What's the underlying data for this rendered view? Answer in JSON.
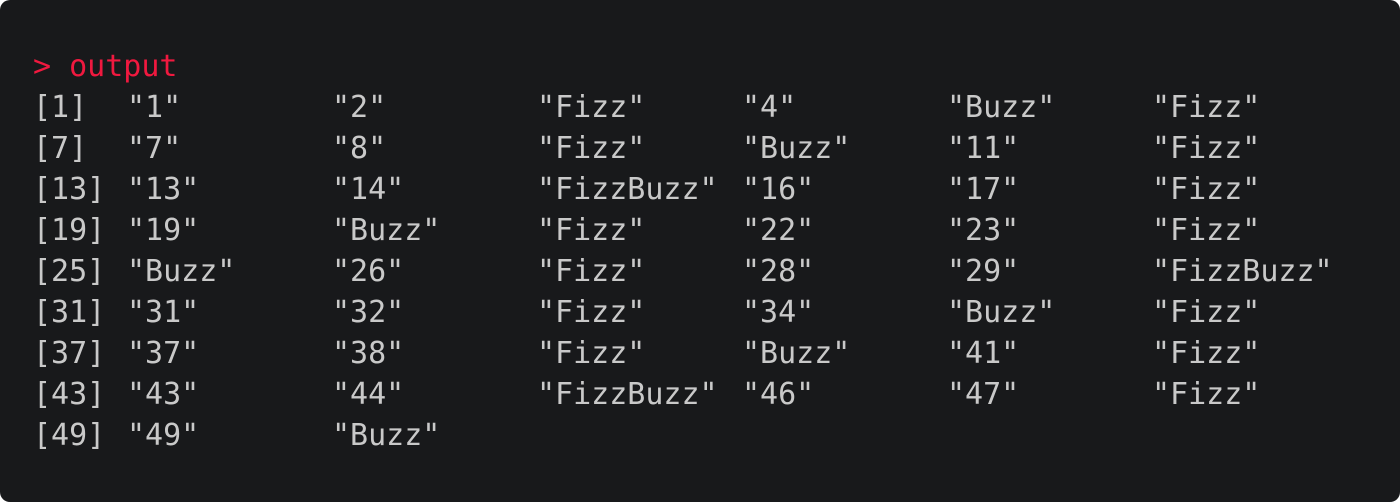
{
  "prompt": {
    "symbol": ">",
    "command": "output",
    "color": "#f0193f"
  },
  "colors": {
    "background": "#18191b",
    "text": "#c9c9c9"
  },
  "rows": [
    {
      "index": "[1]",
      "values": [
        "\"1\"",
        "\"2\"",
        "\"Fizz\"",
        "\"4\"",
        "\"Buzz\"",
        "\"Fizz\""
      ]
    },
    {
      "index": "[7]",
      "values": [
        "\"7\"",
        "\"8\"",
        "\"Fizz\"",
        "\"Buzz\"",
        "\"11\"",
        "\"Fizz\""
      ]
    },
    {
      "index": "[13]",
      "values": [
        "\"13\"",
        "\"14\"",
        "\"FizzBuzz\"",
        "\"16\"",
        "\"17\"",
        "\"Fizz\""
      ]
    },
    {
      "index": "[19]",
      "values": [
        "\"19\"",
        "\"Buzz\"",
        "\"Fizz\"",
        "\"22\"",
        "\"23\"",
        "\"Fizz\""
      ]
    },
    {
      "index": "[25]",
      "values": [
        "\"Buzz\"",
        "\"26\"",
        "\"Fizz\"",
        "\"28\"",
        "\"29\"",
        "\"FizzBuzz\""
      ]
    },
    {
      "index": "[31]",
      "values": [
        "\"31\"",
        "\"32\"",
        "\"Fizz\"",
        "\"34\"",
        "\"Buzz\"",
        "\"Fizz\""
      ]
    },
    {
      "index": "[37]",
      "values": [
        "\"37\"",
        "\"38\"",
        "\"Fizz\"",
        "\"Buzz\"",
        "\"41\"",
        "\"Fizz\""
      ]
    },
    {
      "index": "[43]",
      "values": [
        "\"43\"",
        "\"44\"",
        "\"FizzBuzz\"",
        "\"46\"",
        "\"47\"",
        "\"Fizz\""
      ]
    },
    {
      "index": "[49]",
      "values": [
        "\"49\"",
        "\"Buzz\""
      ]
    }
  ]
}
